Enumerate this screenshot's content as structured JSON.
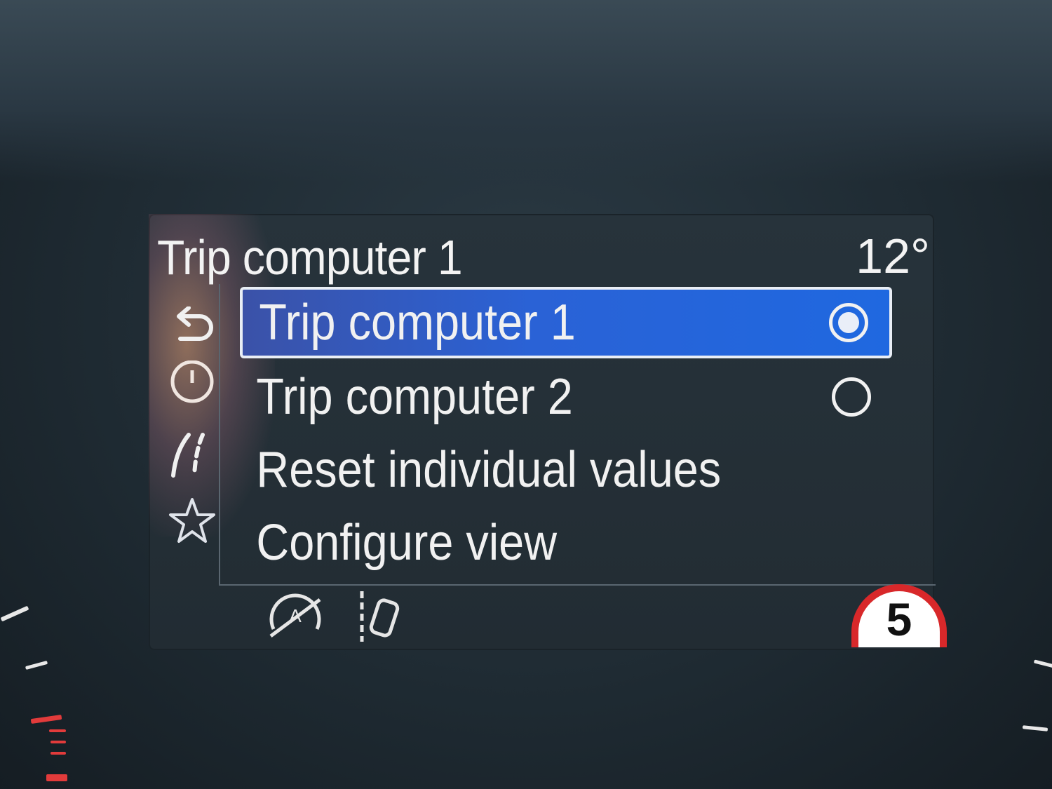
{
  "header": {
    "title": "Trip computer 1",
    "temperature": "12°"
  },
  "menu": {
    "items": [
      {
        "label": "Trip computer 1",
        "selected": true,
        "radio": "selected"
      },
      {
        "label": "Trip computer 2",
        "selected": false,
        "radio": "unselected"
      },
      {
        "label": "Reset individual values"
      },
      {
        "label": "Configure view"
      }
    ]
  },
  "sidebar": {
    "icons": [
      "back-arrow-icon",
      "clock-icon",
      "road-lane-icon",
      "star-icon"
    ]
  },
  "status": {
    "speed_limit": "5",
    "icons": [
      "auto-start-stop-off-icon",
      "lane-keep-assist-icon"
    ]
  },
  "colors": {
    "selection": "#2a62d6",
    "speed_sign_ring": "#d8282a",
    "text": "#f2f2f2"
  }
}
